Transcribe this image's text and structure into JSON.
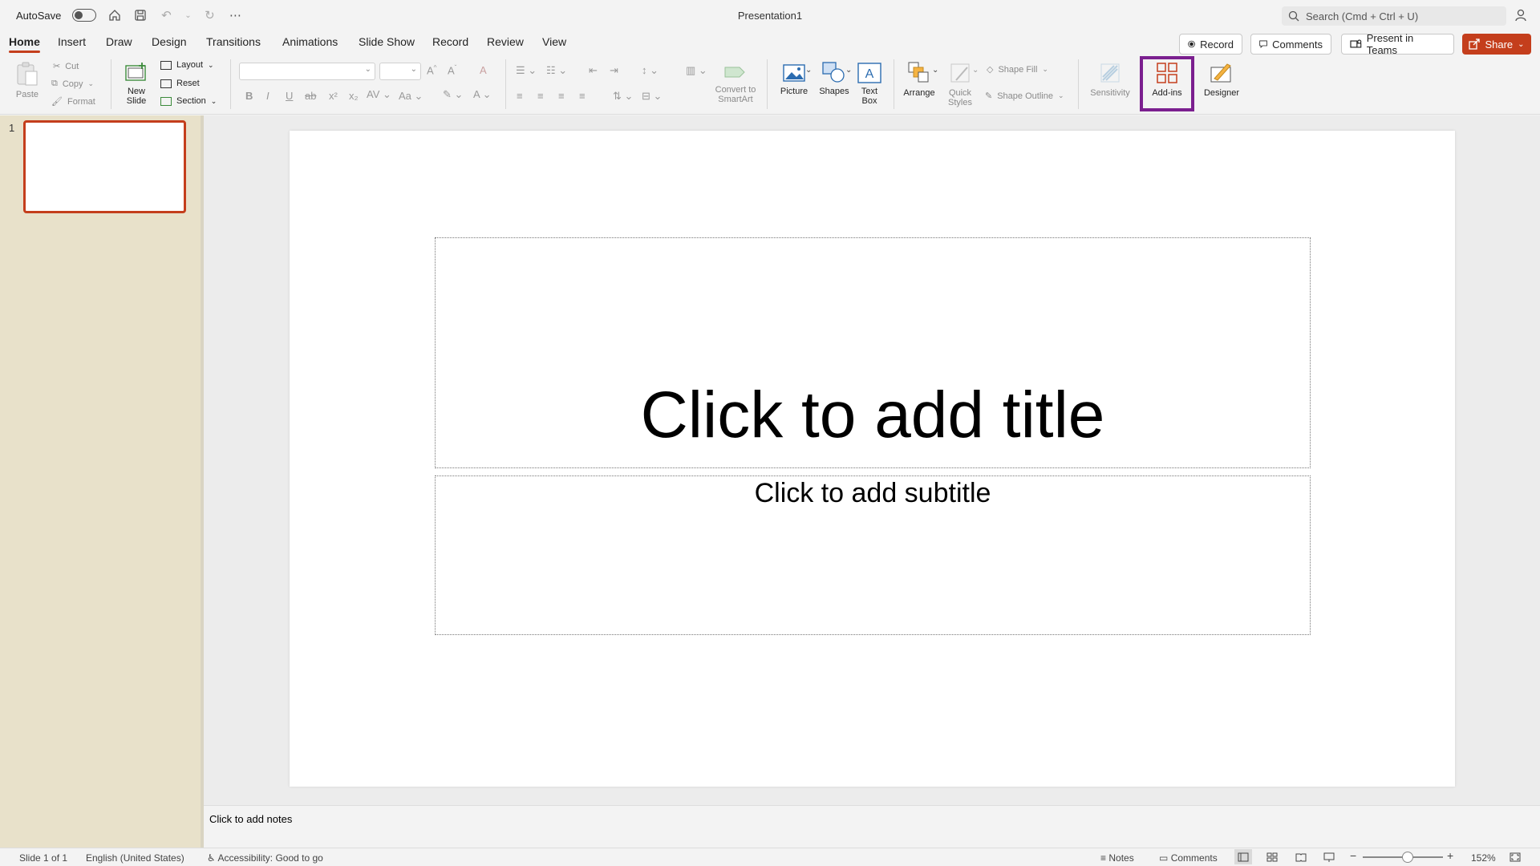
{
  "titlebar": {
    "autosave_label": "AutoSave",
    "doc_title": "Presentation1",
    "search_placeholder": "Search (Cmd + Ctrl + U)"
  },
  "tabs": [
    "Home",
    "Insert",
    "Draw",
    "Design",
    "Transitions",
    "Animations",
    "Slide Show",
    "Record",
    "Review",
    "View"
  ],
  "header_buttons": {
    "record": "Record",
    "comments": "Comments",
    "present_in_teams": "Present in Teams",
    "share": "Share"
  },
  "ribbon": {
    "paste": "Paste",
    "cut": "Cut",
    "copy": "Copy",
    "format": "Format",
    "new_slide_1": "New",
    "new_slide_2": "Slide",
    "layout": "Layout",
    "reset": "Reset",
    "section": "Section",
    "convert_smartart_1": "Convert to",
    "convert_smartart_2": "SmartArt",
    "picture": "Picture",
    "shapes": "Shapes",
    "text_box_1": "Text",
    "text_box_2": "Box",
    "arrange": "Arrange",
    "quick_styles_1": "Quick",
    "quick_styles_2": "Styles",
    "shape_fill": "Shape Fill",
    "shape_outline": "Shape Outline",
    "sensitivity": "Sensitivity",
    "add_ins": "Add-ins",
    "designer": "Designer"
  },
  "slides_panel": {
    "slide_number": "1"
  },
  "slide": {
    "title_placeholder": "Click to add title",
    "subtitle_placeholder": "Click to add subtitle"
  },
  "notes": {
    "placeholder": "Click to add notes"
  },
  "status": {
    "slide_info": "Slide 1 of 1",
    "language": "English (United States)",
    "accessibility": "Accessibility: Good to go",
    "notes": "Notes",
    "comments": "Comments",
    "zoom": "152%"
  },
  "colors": {
    "accent": "#c43e1c",
    "highlight": "#7b1f8f",
    "slide_panel_bg": "#e8e1ca"
  }
}
